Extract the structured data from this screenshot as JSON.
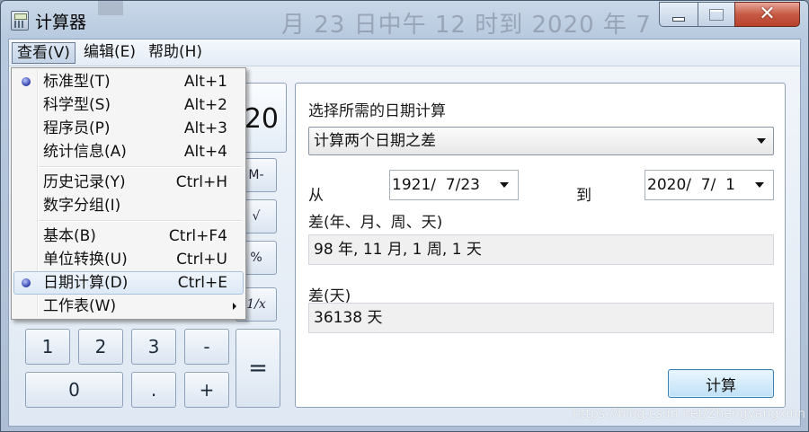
{
  "window": {
    "title": "计算器",
    "background_text": "月 23 日中午 12 时到 2020 年 7"
  },
  "menubar": {
    "view": "查看(V)",
    "edit": "编辑(E)",
    "help": "帮助(H)"
  },
  "view_menu": {
    "items": [
      {
        "label": "标准型(T)",
        "shortcut": "Alt+1",
        "checked": true
      },
      {
        "label": "科学型(S)",
        "shortcut": "Alt+2"
      },
      {
        "label": "程序员(P)",
        "shortcut": "Alt+3"
      },
      {
        "label": "统计信息(A)",
        "shortcut": "Alt+4"
      },
      {
        "label": "历史记录(Y)",
        "shortcut": "Ctrl+H"
      },
      {
        "label": "数字分组(I)",
        "shortcut": ""
      },
      {
        "label": "基本(B)",
        "shortcut": "Ctrl+F4"
      },
      {
        "label": "单位转换(U)",
        "shortcut": "Ctrl+U"
      },
      {
        "label": "日期计算(D)",
        "shortcut": "Ctrl+E",
        "checked": true,
        "highlighted": true
      },
      {
        "label": "工作表(W)",
        "shortcut": "",
        "submenu": true
      }
    ]
  },
  "calculator": {
    "display": "20",
    "keys": {
      "m_minus": "M-",
      "sqrt": "√",
      "percent": "%",
      "reciprocal": "1/x",
      "one": "1",
      "two": "2",
      "three": "3",
      "minus": "-",
      "equals": "=",
      "zero": "0",
      "dot": ".",
      "plus": "+"
    }
  },
  "date_panel": {
    "heading": "选择所需的日期计算",
    "mode": "计算两个日期之差",
    "from_label": "从",
    "from_date": "1921/  7/23",
    "to_label": "到",
    "to_date": "2020/  7/  1",
    "diff_label": "差(年、月、周、天)",
    "diff_value": "98 年, 11 月, 1 周, 1 天",
    "days_label": "差(天)",
    "days_value": "36138 天",
    "calc_button": "计算"
  },
  "watermark": "https://blog.csdn.net/Zhengyangxinn"
}
